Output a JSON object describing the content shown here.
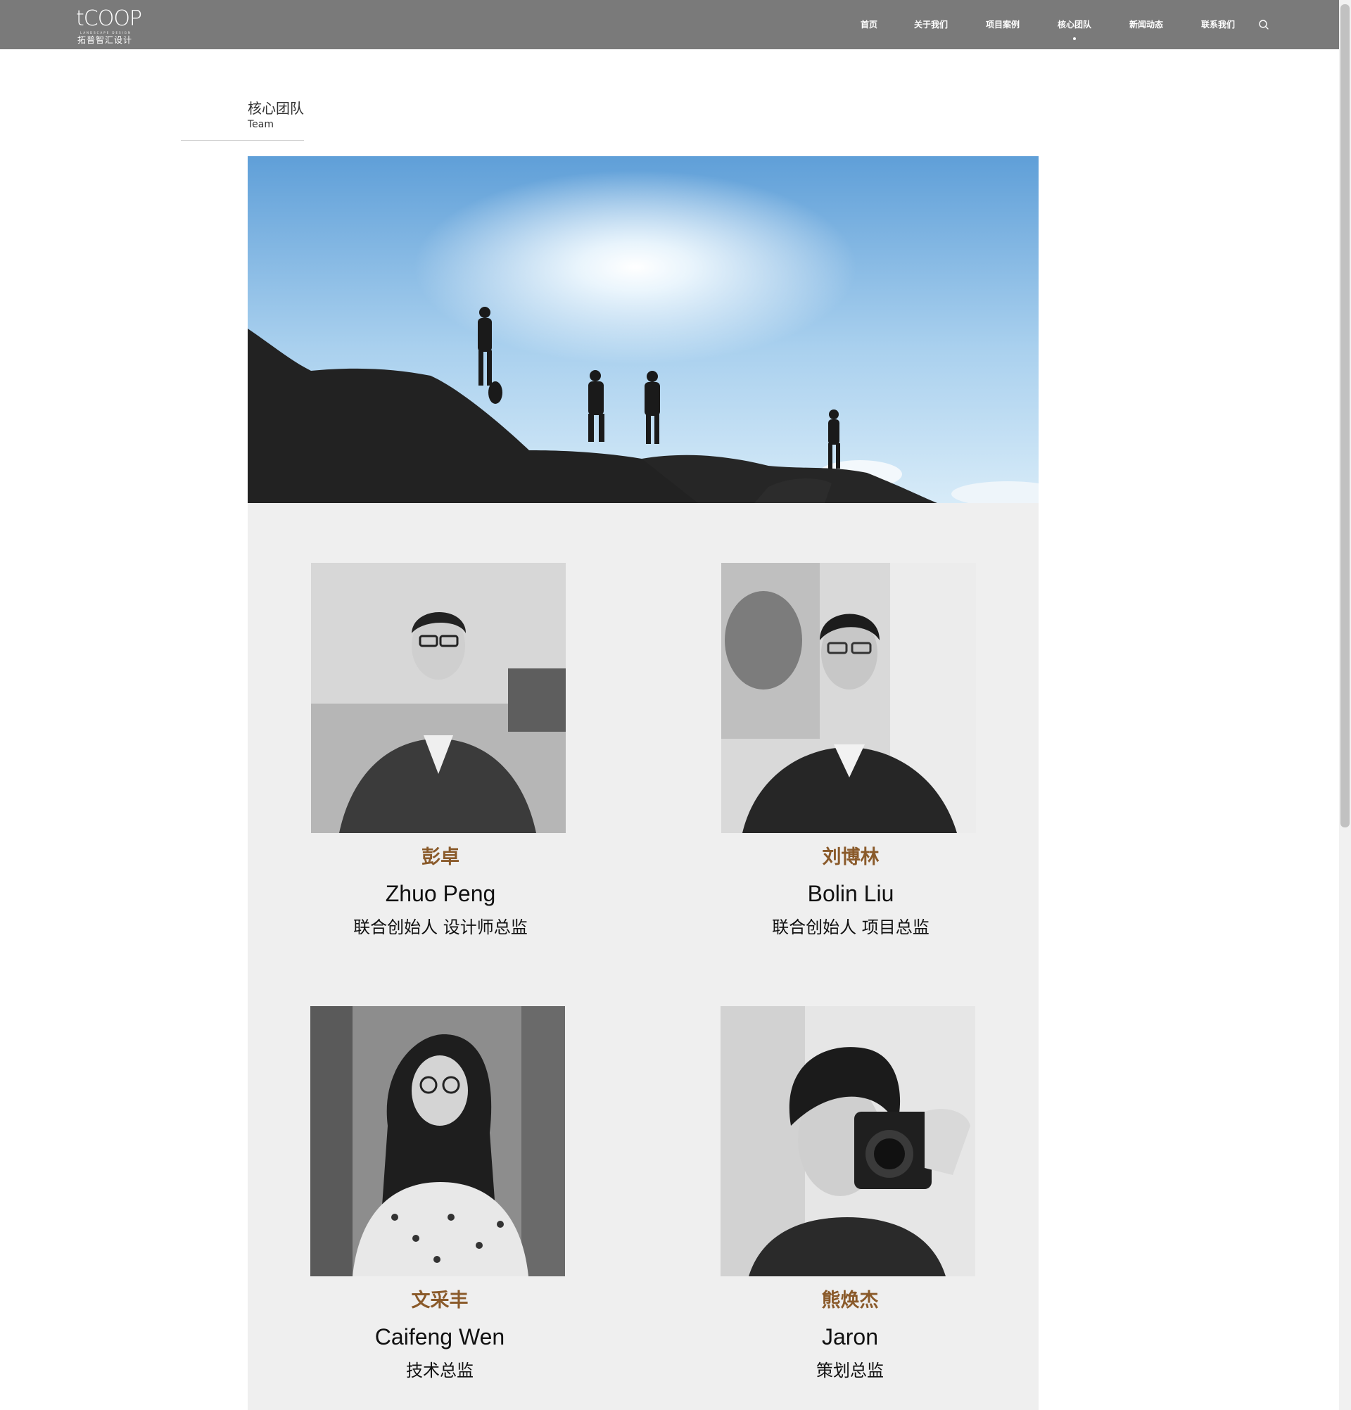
{
  "header": {
    "logo_word": "tCOOP",
    "logo_tag": "LANDSCAPE DESIGN",
    "logo_cn": "拓普智汇设计",
    "nav": [
      {
        "label": "首页",
        "active": false
      },
      {
        "label": "关于我们",
        "active": false
      },
      {
        "label": "项目案例",
        "active": false
      },
      {
        "label": "核心团队",
        "active": true
      },
      {
        "label": "新闻动态",
        "active": false
      },
      {
        "label": "联系我们",
        "active": false
      }
    ],
    "search_icon": "search-icon"
  },
  "section": {
    "title_cn": "核心团队",
    "title_en": "Team"
  },
  "members": [
    {
      "name_cn": "彭卓",
      "name_en": "Zhuo Peng",
      "role": "联合创始人 设计师总监"
    },
    {
      "name_cn": "刘博林",
      "name_en": "Bolin  Liu",
      "role": "联合创始人 项目总监"
    },
    {
      "name_cn": "文采丰",
      "name_en": "Caifeng Wen",
      "role": "技术总监"
    },
    {
      "name_cn": "熊焕杰",
      "name_en": "Jaron",
      "role": "策划总监"
    }
  ],
  "colors": {
    "header_bg": "#7a7a7a",
    "name_accent": "#8a5a2a",
    "content_bg": "#efefef"
  }
}
